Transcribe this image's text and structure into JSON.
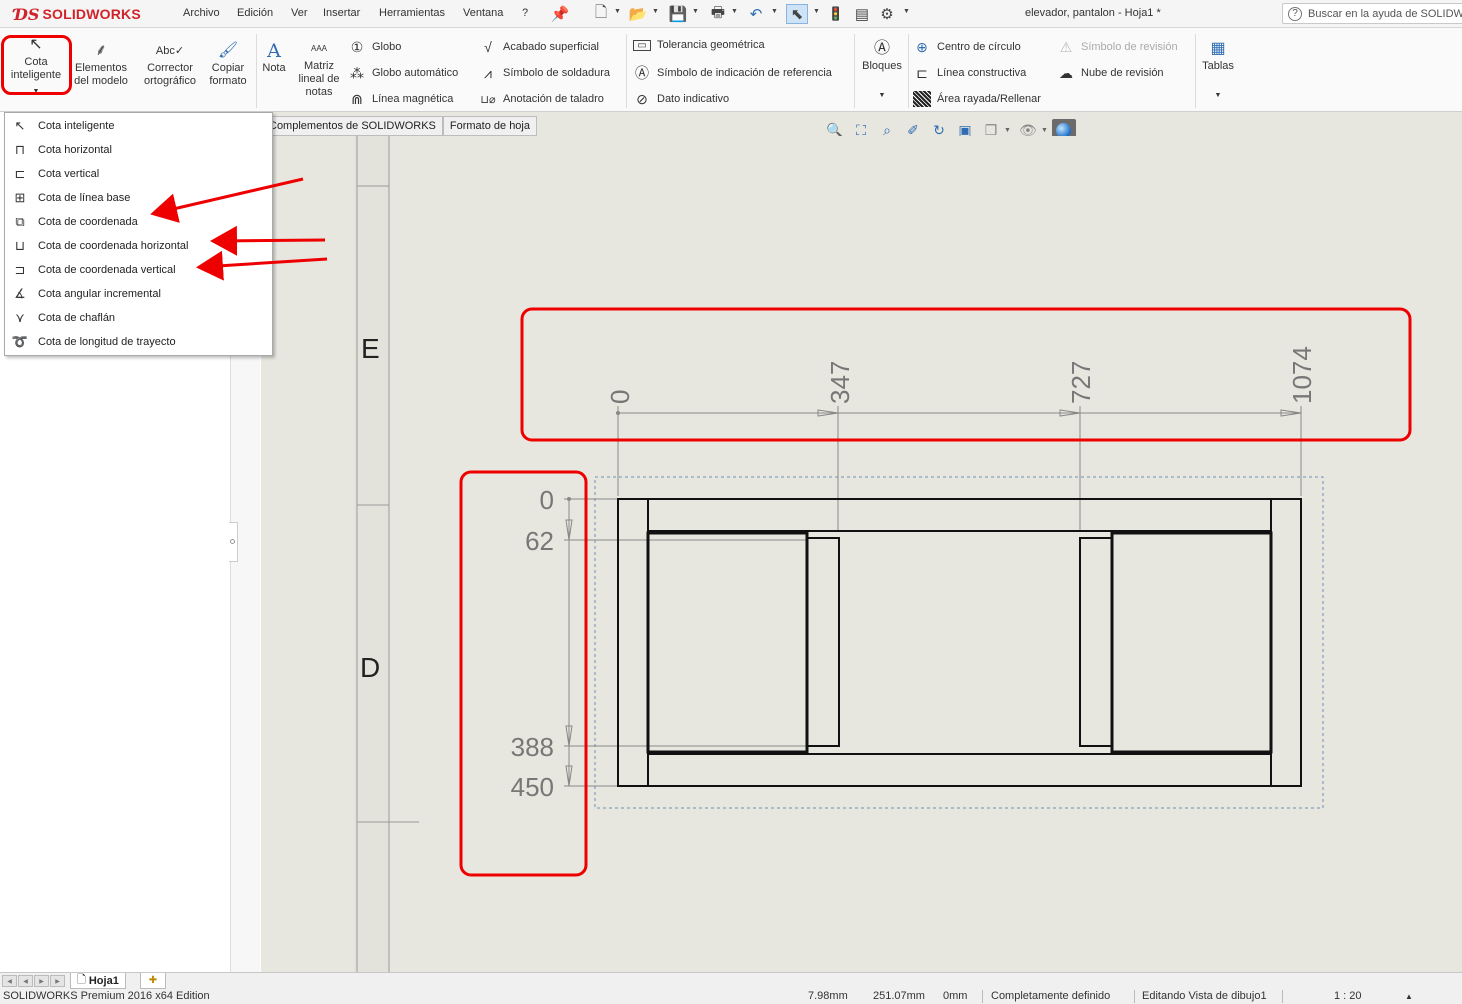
{
  "app": {
    "brand": "SOLIDWORKS",
    "document_title": "elevador, pantalon - Hoja1 *",
    "search_placeholder": "Buscar en la ayuda de SOLIDWORKS"
  },
  "menubar": {
    "items": [
      "Archivo",
      "Edición",
      "Ver",
      "Insertar",
      "Herramientas",
      "Ventana",
      "?"
    ]
  },
  "ribbon": {
    "smart_dimension": "Cota inteligente",
    "model_items": "Elementos del modelo",
    "spell_checker": "Corrector ortográfico",
    "format_painter": "Copiar formato",
    "note": "Nota",
    "linear_note_pattern": "Matriz lineal de notas",
    "balloon": "Globo",
    "auto_balloon": "Globo automático",
    "magnetic_line": "Línea magnética",
    "surface_finish": "Acabado superficial",
    "weld_symbol": "Símbolo de soldadura",
    "hole_callout": "Anotación de taladro",
    "geometric_tolerance": "Tolerancia geométrica",
    "datum_feature": "Símbolo de indicación de referencia",
    "datum_target": "Dato indicativo",
    "blocks": "Bloques",
    "center_mark": "Centro de círculo",
    "centerline": "Línea constructiva",
    "area_hatch": "Área rayada/Rellenar",
    "revision_symbol": "Símbolo de revisión",
    "revision_cloud": "Nube de revisión",
    "tables": "Tablas"
  },
  "tabs": [
    "Complementos de SOLIDWORKS",
    "Formato de hoja"
  ],
  "dropdown": {
    "items": [
      {
        "label": "Cota inteligente",
        "icon": "smart-dimension-icon"
      },
      {
        "label": "Cota horizontal",
        "icon": "horizontal-dimension-icon"
      },
      {
        "label": "Cota vertical",
        "icon": "vertical-dimension-icon"
      },
      {
        "label": "Cota de línea base",
        "icon": "baseline-dimension-icon"
      },
      {
        "label": "Cota de coordenada",
        "icon": "ordinate-dimension-icon"
      },
      {
        "label": "Cota de coordenada horizontal",
        "icon": "horizontal-ordinate-icon"
      },
      {
        "label": "Cota de coordenada vertical",
        "icon": "vertical-ordinate-icon"
      },
      {
        "label": "Cota angular incremental",
        "icon": "angular-running-icon"
      },
      {
        "label": "Cota de chaflán",
        "icon": "chamfer-dimension-icon"
      },
      {
        "label": "Cota de longitud de trayecto",
        "icon": "path-length-icon"
      }
    ]
  },
  "drawing": {
    "zone_letters": [
      "E",
      "D"
    ],
    "horizontal_ordinates": [
      "0",
      "347",
      "727",
      "1074"
    ],
    "vertical_ordinates": [
      "0",
      "62",
      "388",
      "450"
    ]
  },
  "sheet": {
    "tab": "Hoja1"
  },
  "status": {
    "edition": "SOLIDWORKS Premium 2016 x64 Edition",
    "x": "7.98mm",
    "y": "251.07mm",
    "z": "0mm",
    "definition": "Completamente definido",
    "editing": "Editando Vista de dibujo1",
    "scale": "1 : 20"
  },
  "colors": {
    "highlight": "#e00000",
    "canvas": "#e8e7df",
    "dimension": "#777777"
  }
}
